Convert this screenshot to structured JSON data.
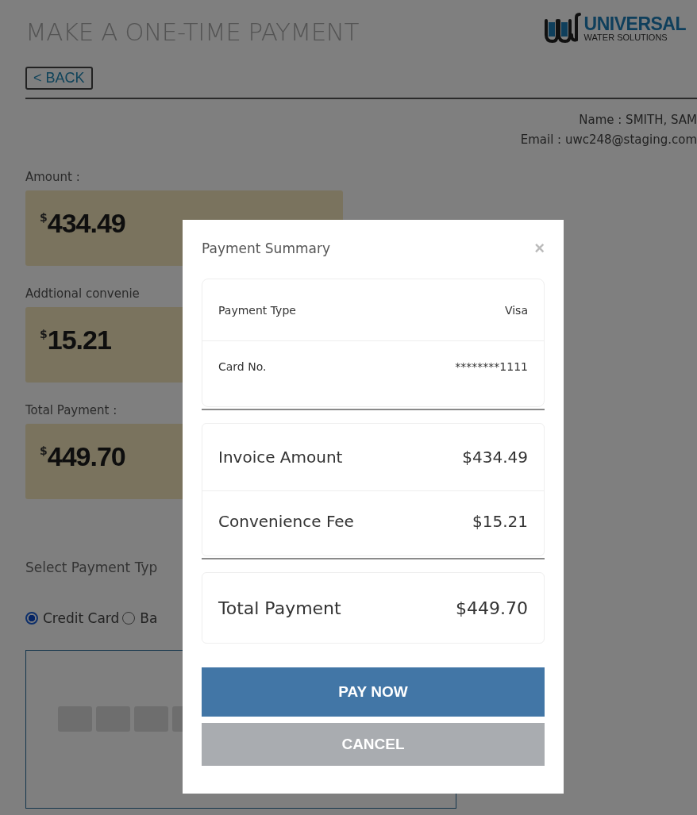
{
  "page": {
    "title": "MAKE A ONE-TIME PAYMENT",
    "logo": {
      "name": "UNIVERSAL",
      "tagline": "WATER SOLUTIONS"
    },
    "back_button": "< BACK",
    "customer": {
      "name": "Name : SMITH, SAM",
      "email": "Email : uwc248@staging.com"
    },
    "amount_fields": [
      {
        "label": "Amount :",
        "currency": "$",
        "value": "434.49"
      },
      {
        "label": "Addtional convenie",
        "currency": "$",
        "value": "15.21"
      },
      {
        "label": "Total Payment :",
        "currency": "$",
        "value": "449.70"
      }
    ],
    "payment_type": {
      "label": "Select Payment Typ",
      "options": [
        {
          "label": "Credit Card",
          "selected": true
        },
        {
          "label": "Ba",
          "selected": false
        }
      ]
    }
  },
  "modal": {
    "title": "Payment Summary",
    "close": "×",
    "sections": [
      {
        "kind": "details",
        "rows": [
          {
            "label": "Payment Type",
            "value": "Visa"
          },
          {
            "label": "Card No.",
            "value": "********1111"
          }
        ]
      },
      {
        "kind": "amounts",
        "rows": [
          {
            "label": "Invoice Amount",
            "value": "$434.49"
          },
          {
            "label": "Convenience Fee",
            "value": "$15.21"
          }
        ]
      },
      {
        "kind": "total",
        "rows": [
          {
            "label": "Total Payment",
            "value": "$449.70"
          }
        ]
      }
    ],
    "buttons": [
      {
        "label": "PAY NOW",
        "kind": "primary"
      },
      {
        "label": "CANCEL",
        "kind": "secondary"
      }
    ]
  }
}
